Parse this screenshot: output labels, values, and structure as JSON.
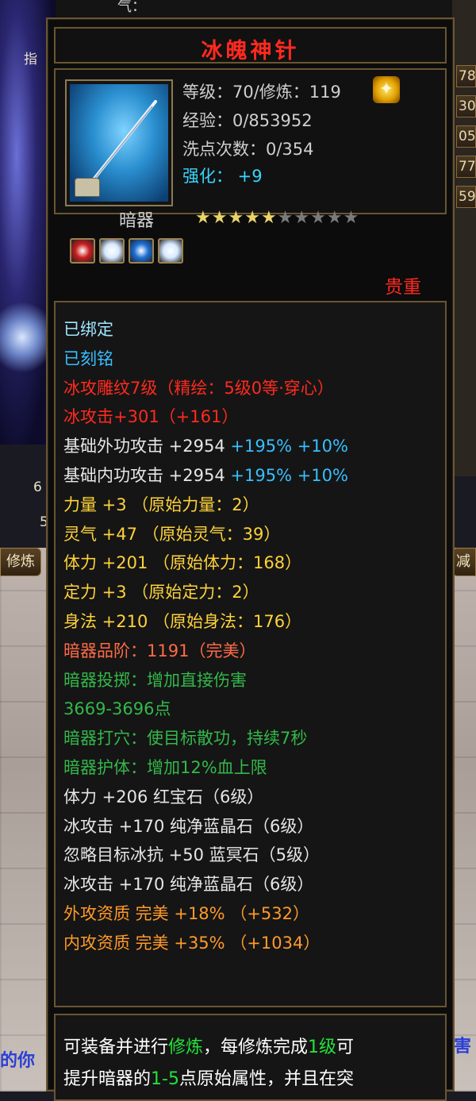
{
  "background": {
    "top_bar_text": "气：",
    "top_bar_italic": "",
    "left_fragments": [
      "指",
      "6",
      "5"
    ],
    "left_tab": "修炼",
    "right_strips": [
      "78",
      "30",
      "05",
      "77",
      "59"
    ],
    "right_tab": "减",
    "bottom_left": "的你",
    "bottom_right": "害"
  },
  "item": {
    "name": "冰魄神针",
    "level_line": "等级：70/修炼：119",
    "exp_line": "经验：0/853952",
    "wash_line": "洗点次数：0/354",
    "enhance_line": "强化： +9",
    "type": "暗器",
    "stars_total": 10,
    "stars_filled": 5,
    "grade": "贵重",
    "gem_slots": [
      {
        "color": "#c81e1e"
      },
      {
        "color": "#d7e9ff"
      },
      {
        "color": "#1c6fd6"
      },
      {
        "color": "#d7e9ff"
      }
    ]
  },
  "attributes": [
    {
      "text": "已绑定",
      "color_class": "c-cyan"
    },
    {
      "text": "已刻铭",
      "color_class": "c-blue"
    },
    {
      "text": "冰攻雕纹7级（精绘：5级0等·穿心）",
      "color_class": "c-red"
    },
    {
      "text": "冰攻击+301（+161）",
      "color_class": "c-red"
    },
    {
      "text": "基础外功攻击 +2954",
      "extra": " +195% +10%",
      "color_class": "c-white"
    },
    {
      "text": "基础内功攻击 +2954",
      "extra": " +195% +10%",
      "color_class": "c-white"
    },
    {
      "text": "力量 +3 （原始力量：2）",
      "color_class": "c-yellow"
    },
    {
      "text": "灵气 +47 （原始灵气：39）",
      "color_class": "c-yellow"
    },
    {
      "text": "体力 +201 （原始体力：168）",
      "color_class": "c-yellow"
    },
    {
      "text": "定力 +3 （原始定力：2）",
      "color_class": "c-yellow"
    },
    {
      "text": "身法 +210 （原始身法：176）",
      "color_class": "c-yellow"
    },
    {
      "text": "暗器品阶：1191（完美）",
      "color_class": "c-salmon"
    },
    {
      "text": "暗器投掷：增加直接伤害",
      "color_class": "c-green"
    },
    {
      "text": "3669-3696点",
      "color_class": "c-green"
    },
    {
      "text": "暗器打穴：使目标散功，持续7秒",
      "color_class": "c-green"
    },
    {
      "text": "暗器护体：增加12%血上限",
      "color_class": "c-green"
    },
    {
      "text": "体力 +206 红宝石（6级）",
      "color_class": "c-white"
    },
    {
      "text": "冰攻击 +170 纯净蓝晶石（6级）",
      "color_class": "c-white"
    },
    {
      "text": "忽略目标冰抗 +50 蓝冥石（5级）",
      "color_class": "c-white"
    },
    {
      "text": "冰攻击 +170 纯净蓝晶石（6级）",
      "color_class": "c-white"
    },
    {
      "text": "外攻资质  完美 +18% （+532）",
      "color_class": "c-orange"
    },
    {
      "text": "内攻资质  完美 +35% （+1034）",
      "color_class": "c-orange"
    }
  ],
  "description": {
    "line1_a": "可装备并进行",
    "line1_hl1": "修炼",
    "line1_b": "，每修炼完成",
    "line1_hl2": "1级",
    "line1_c": "可",
    "line2_a": "提升暗器的",
    "line2_hl": "1-5",
    "line2_b": "点原始属性，并且在突"
  }
}
